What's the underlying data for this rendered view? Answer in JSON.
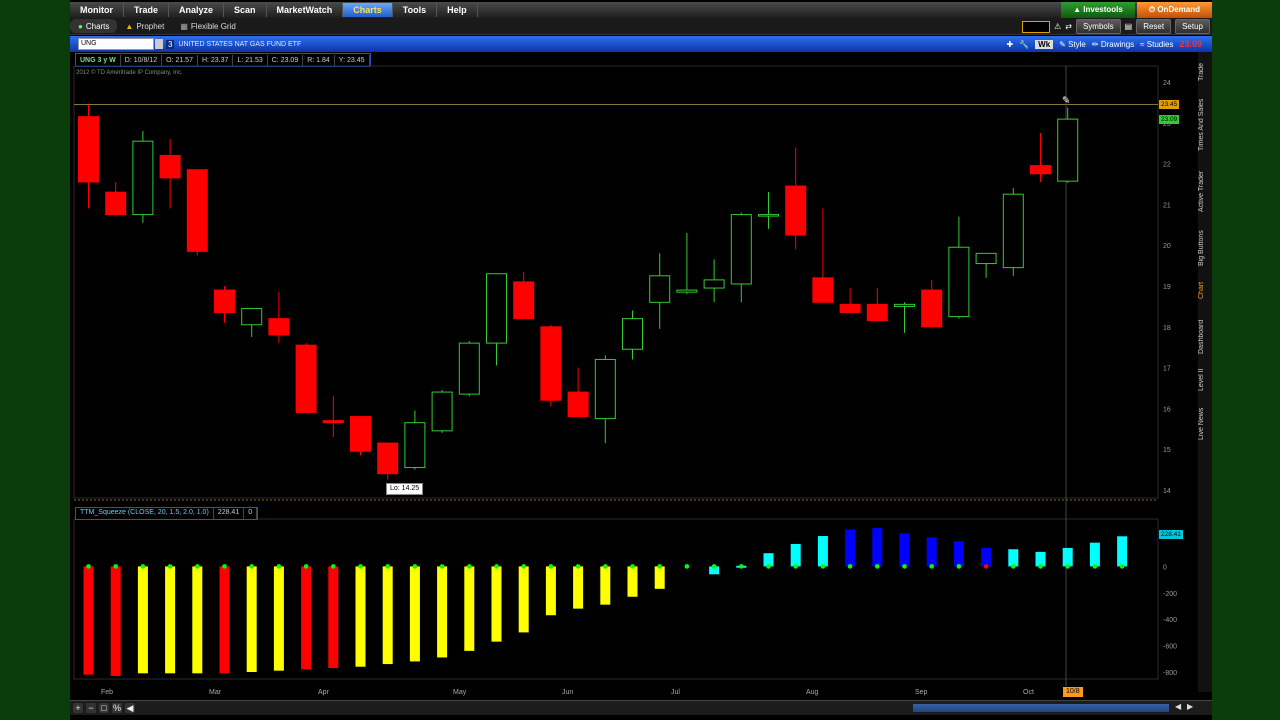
{
  "nav": {
    "tabs": [
      "Monitor",
      "Trade",
      "Analyze",
      "Scan",
      "MarketWatch",
      "Charts",
      "Tools",
      "Help"
    ],
    "active": "Charts",
    "investools": "Investools",
    "ondemand": "OnDemand"
  },
  "subnav": {
    "tabs": [
      "Charts",
      "Prophet",
      "Flexible Grid"
    ],
    "symbols": "Symbols",
    "reset": "Reset",
    "setup": "Setup"
  },
  "symbol_bar": {
    "symbol": "UNG",
    "link_number": "3",
    "description": "UNITED STATES NAT GAS FUND ETF",
    "aggregation": "Wk",
    "style": "Style",
    "drawings": "Drawings",
    "studies": "Studies",
    "last_price": "23.09"
  },
  "info": {
    "symbol_period": "UNG 3 y W",
    "date": "D: 10/8/12",
    "open": "O: 21.57",
    "high": "H: 23.37",
    "low": "L: 21.53",
    "close": "C: 23.09",
    "range": "R: 1.84",
    "y": "Y: 23.45"
  },
  "copyright": "2012 © TD Ameritrade IP Company, Inc.",
  "low_label": "Lo: 14.25",
  "price_tags": {
    "cursor": "23.45",
    "last": "23.09",
    "squeeze": "228.41"
  },
  "squeeze": {
    "name": "TTM_Squeeze (CLOSE, 20, 1.5, 2.0, 1.0)",
    "value": "228.41",
    "extra": "0"
  },
  "months": [
    "Feb",
    "Mar",
    "Apr",
    "May",
    "Jun",
    "Jul",
    "Aug",
    "Sep",
    "Oct"
  ],
  "current_date": "10/8",
  "right_tabs": [
    "Trade",
    "Times And Sales",
    "Active Trader",
    "Big Buttons",
    "Chart",
    "Dashboard",
    "Level II",
    "Live News"
  ],
  "colors": {
    "up": "#33cc33",
    "down": "#ff0000",
    "accent": "#ff9a1e",
    "sq_cyan": "#00ffff",
    "sq_blue": "#0000ff",
    "sq_yellow": "#ffff00",
    "sq_red": "#ff0000"
  },
  "chart_data": {
    "type": "candlestick",
    "price_axis": {
      "min": 14,
      "max": 24,
      "ticks": [
        24,
        23,
        22,
        21,
        20,
        19,
        18,
        17,
        16,
        15,
        14
      ]
    },
    "candles": [
      {
        "o": 23.15,
        "h": 23.45,
        "l": 20.9,
        "c": 21.55
      },
      {
        "o": 21.3,
        "h": 21.55,
        "l": 20.85,
        "c": 20.75
      },
      {
        "o": 20.75,
        "h": 22.8,
        "l": 20.55,
        "c": 22.55
      },
      {
        "o": 22.2,
        "h": 22.6,
        "l": 20.9,
        "c": 21.65
      },
      {
        "o": 21.85,
        "h": 21.85,
        "l": 19.75,
        "c": 19.85
      },
      {
        "o": 18.9,
        "h": 19.0,
        "l": 18.1,
        "c": 18.35
      },
      {
        "o": 18.05,
        "h": 18.45,
        "l": 17.75,
        "c": 18.45
      },
      {
        "o": 18.2,
        "h": 18.85,
        "l": 17.6,
        "c": 17.8
      },
      {
        "o": 17.55,
        "h": 17.6,
        "l": 15.9,
        "c": 15.9
      },
      {
        "o": 15.7,
        "h": 16.3,
        "l": 15.3,
        "c": 15.65
      },
      {
        "o": 15.8,
        "h": 15.8,
        "l": 14.85,
        "c": 14.95
      },
      {
        "o": 15.15,
        "h": 15.15,
        "l": 14.25,
        "c": 14.4
      },
      {
        "o": 14.55,
        "h": 15.95,
        "l": 14.5,
        "c": 15.65
      },
      {
        "o": 15.45,
        "h": 16.45,
        "l": 15.4,
        "c": 16.4
      },
      {
        "o": 16.35,
        "h": 17.65,
        "l": 16.3,
        "c": 17.6
      },
      {
        "o": 17.6,
        "h": 19.25,
        "l": 17.05,
        "c": 19.3
      },
      {
        "o": 19.1,
        "h": 19.35,
        "l": 18.2,
        "c": 18.2
      },
      {
        "o": 18.0,
        "h": 18.05,
        "l": 16.05,
        "c": 16.2
      },
      {
        "o": 16.4,
        "h": 17.0,
        "l": 15.8,
        "c": 15.8
      },
      {
        "o": 15.75,
        "h": 17.3,
        "l": 15.15,
        "c": 17.2
      },
      {
        "o": 17.45,
        "h": 18.4,
        "l": 17.2,
        "c": 18.2
      },
      {
        "o": 18.6,
        "h": 19.8,
        "l": 17.95,
        "c": 19.25
      },
      {
        "o": 18.85,
        "h": 20.3,
        "l": 18.8,
        "c": 18.9
      },
      {
        "o": 18.95,
        "h": 19.65,
        "l": 18.6,
        "c": 19.15
      },
      {
        "o": 19.05,
        "h": 20.8,
        "l": 18.6,
        "c": 20.75
      },
      {
        "o": 20.75,
        "h": 21.3,
        "l": 20.4,
        "c": 20.75
      },
      {
        "o": 21.45,
        "h": 22.4,
        "l": 19.9,
        "c": 20.25
      },
      {
        "o": 19.2,
        "h": 20.9,
        "l": 18.9,
        "c": 18.6
      },
      {
        "o": 18.55,
        "h": 18.95,
        "l": 18.4,
        "c": 18.35
      },
      {
        "o": 18.55,
        "h": 18.95,
        "l": 18.2,
        "c": 18.15
      },
      {
        "o": 18.5,
        "h": 18.6,
        "l": 17.85,
        "c": 18.55
      },
      {
        "o": 18.9,
        "h": 19.15,
        "l": 18.05,
        "c": 18.0
      },
      {
        "o": 18.25,
        "h": 20.7,
        "l": 18.2,
        "c": 19.95
      },
      {
        "o": 19.55,
        "h": 19.8,
        "l": 19.2,
        "c": 19.8
      },
      {
        "o": 19.45,
        "h": 21.4,
        "l": 19.25,
        "c": 21.25
      },
      {
        "o": 21.95,
        "h": 22.75,
        "l": 21.55,
        "c": 21.75
      },
      {
        "o": 21.57,
        "h": 23.37,
        "l": 21.53,
        "c": 23.09
      }
    ],
    "squeeze_axis": {
      "min": -800,
      "max": 200,
      "ticks": [
        0,
        -200,
        -400,
        -600,
        -800
      ]
    },
    "squeeze_values": [
      -820,
      -830,
      -810,
      -810,
      -810,
      -810,
      -800,
      -790,
      -780,
      -770,
      -760,
      -740,
      -720,
      -690,
      -640,
      -570,
      -500,
      -370,
      -320,
      -290,
      -230,
      -170,
      -100,
      -60,
      5,
      100,
      170,
      230,
      280,
      290,
      250,
      220,
      190,
      140,
      130,
      110,
      140,
      180,
      228
    ],
    "squeeze_colors": [
      "red",
      "red",
      "yellow",
      "yellow",
      "yellow",
      "red",
      "yellow",
      "yellow",
      "red",
      "red",
      "yellow",
      "yellow",
      "yellow",
      "yellow",
      "yellow",
      "yellow",
      "yellow",
      "yellow",
      "yellow",
      "yellow",
      "yellow",
      "yellow",
      "none",
      "cyan",
      "cyan",
      "cyan",
      "cyan",
      "cyan",
      "blue",
      "blue",
      "blue",
      "blue",
      "blue",
      "blue",
      "cyan",
      "cyan",
      "cyan",
      "cyan",
      "cyan"
    ],
    "dot_colors": [
      "green",
      "green",
      "green",
      "green",
      "green",
      "green",
      "green",
      "green",
      "green",
      "green",
      "green",
      "green",
      "green",
      "green",
      "green",
      "green",
      "green",
      "green",
      "green",
      "green",
      "green",
      "green",
      "green",
      "green",
      "green",
      "green",
      "green",
      "green",
      "green",
      "green",
      "green",
      "green",
      "green",
      "red",
      "green",
      "green",
      "green",
      "green",
      "green"
    ]
  }
}
